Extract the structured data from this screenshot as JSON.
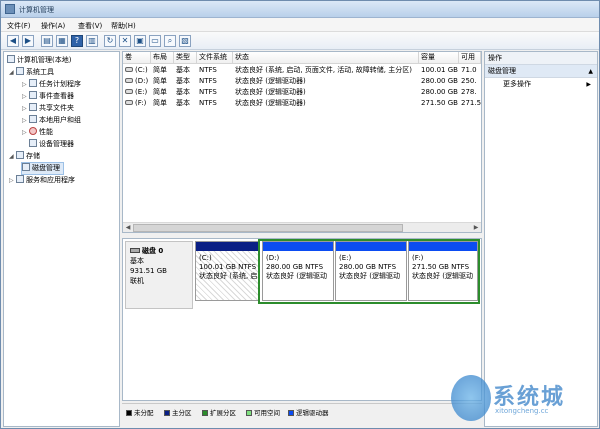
{
  "window": {
    "title": "计算机管理"
  },
  "menu": [
    "文件(F)",
    "操作(A)",
    "查看(V)",
    "帮助(H)"
  ],
  "tree": {
    "root": "计算机管理(本地)",
    "system_tools": "系统工具",
    "children": [
      "任务计划程序",
      "事件查看器",
      "共享文件夹",
      "本地用户和组",
      "性能",
      "设备管理器"
    ],
    "storage": "存储",
    "disk_management": "磁盘管理",
    "services": "服务和应用程序"
  },
  "volume_table": {
    "headers": [
      "卷",
      "布局",
      "类型",
      "文件系统",
      "状态",
      "容量",
      "可用"
    ],
    "rows": [
      [
        "(C:)",
        "简单",
        "基本",
        "NTFS",
        "状态良好 (系统, 启动, 页面文件, 活动, 故障转储, 主分区)",
        "100.01 GB",
        "71.0"
      ],
      [
        "(D:)",
        "简单",
        "基本",
        "NTFS",
        "状态良好 (逻辑驱动器)",
        "280.00 GB",
        "250."
      ],
      [
        "(E:)",
        "简单",
        "基本",
        "NTFS",
        "状态良好 (逻辑驱动器)",
        "280.00 GB",
        "278."
      ],
      [
        "(F:)",
        "简单",
        "基本",
        "NTFS",
        "状态良好 (逻辑驱动器)",
        "271.50 GB",
        "271.5"
      ]
    ]
  },
  "disk": {
    "name": "磁盘 0",
    "type": "基本",
    "size": "931.51 GB",
    "status": "联机",
    "partitions": [
      {
        "drive": "(C:)",
        "size": "100.01 GB NTFS",
        "status": "状态良好 (系统, 启",
        "kind": "primary"
      },
      {
        "drive": "(D:)",
        "size": "280.00 GB NTFS",
        "status": "状态良好 (逻辑驱动",
        "kind": "logical"
      },
      {
        "drive": "(E:)",
        "size": "280.00 GB NTFS",
        "status": "状态良好 (逻辑驱动",
        "kind": "logical"
      },
      {
        "drive": "(F:)",
        "size": "271.50 GB NTFS",
        "status": "状态良好 (逻辑驱动",
        "kind": "logical"
      }
    ]
  },
  "legend": [
    {
      "label": "未分配",
      "color": "#000000"
    },
    {
      "label": "主分区",
      "color": "#0a1f85"
    },
    {
      "label": "扩展分区",
      "color": "#2c8c2c"
    },
    {
      "label": "可用空间",
      "color": "#7fe07f"
    },
    {
      "label": "逻辑驱动器",
      "color": "#0b4cf2"
    }
  ],
  "actions": {
    "header": "操作",
    "section": "磁盘管理",
    "more": "更多操作"
  },
  "watermark": {
    "text": "系统城",
    "url": "xitongcheng.cc"
  }
}
